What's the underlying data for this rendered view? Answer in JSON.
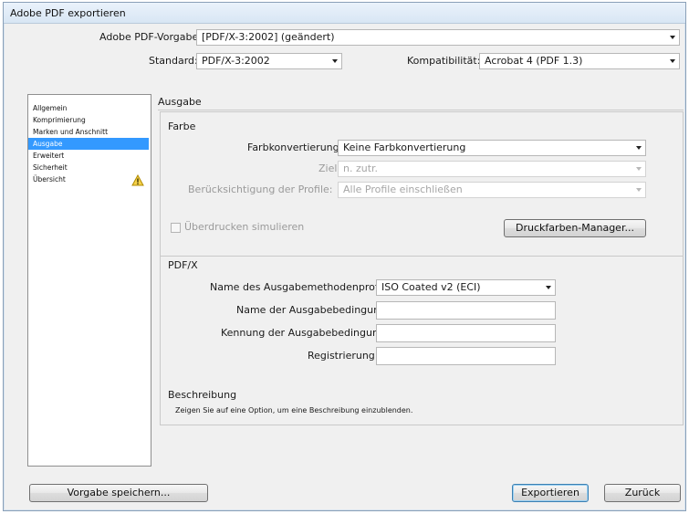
{
  "window": {
    "title": "Adobe PDF exportieren"
  },
  "preset": {
    "label": "Adobe PDF-Vorgabe:",
    "value": "[PDF/X-3:2002] (geändert)"
  },
  "standard": {
    "label": "Standard:",
    "value": "PDF/X-3:2002"
  },
  "compat": {
    "label": "Kompatibilität:",
    "value": "Acrobat 4 (PDF 1.3)"
  },
  "sidebar": {
    "items": [
      {
        "label": "Allgemein"
      },
      {
        "label": "Komprimierung"
      },
      {
        "label": "Marken und Anschnitt"
      },
      {
        "label": "Ausgabe"
      },
      {
        "label": "Erweitert"
      },
      {
        "label": "Sicherheit"
      },
      {
        "label": "Übersicht"
      }
    ],
    "selected_index": 3
  },
  "section_title": "Ausgabe",
  "color": {
    "heading": "Farbe",
    "conversion_label": "Farbkonvertierung:",
    "conversion_value": "Keine Farbkonvertierung",
    "target_label": "Ziel:",
    "target_value": "n. zutr.",
    "profile_label": "Berücksichtigung der Profile:",
    "profile_value": "Alle Profile einschließen",
    "overprint_label": "Überdrucken simulieren",
    "ink_manager_label": "Druckfarben-Manager..."
  },
  "pdfx": {
    "heading": "PDF/X",
    "output_profile_label": "Name des Ausgabemethodenprofils:",
    "output_profile_value": "ISO Coated v2 (ECI)",
    "condition_name_label": "Name der Ausgabebedingung:",
    "condition_name_value": "",
    "condition_id_label": "Kennung der Ausgabebedingung:",
    "condition_id_value": "",
    "registry_label": "Registrierung:",
    "registry_value": ""
  },
  "description": {
    "heading": "Beschreibung",
    "text": "Zeigen Sie auf eine Option, um eine Beschreibung einzublenden."
  },
  "buttons": {
    "save_preset": "Vorgabe speichern...",
    "export": "Exportieren",
    "back": "Zurück"
  }
}
